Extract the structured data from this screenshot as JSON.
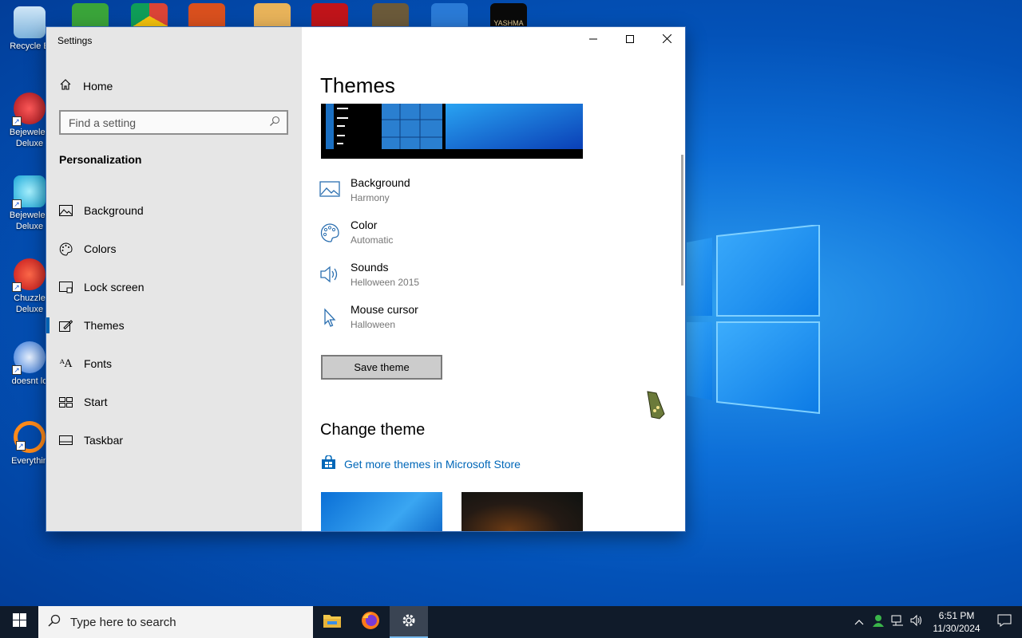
{
  "desktop": {
    "icons": [
      {
        "label": "Recycle B",
        "icon": "recycle-bin-icon"
      },
      {
        "label": "Bejewelec Deluxe",
        "icon": "bejeweled2-icon"
      },
      {
        "label": "Bejewelec Deluxe",
        "icon": "bejeweled-icon"
      },
      {
        "label": "Chuzzle Deluxe",
        "icon": "chuzzle-icon"
      },
      {
        "label": "doesnt lo",
        "icon": "thunderbird-icon"
      },
      {
        "label": "Everythin",
        "icon": "everything-search-icon"
      }
    ],
    "top_icon_text": "YASHMA"
  },
  "window": {
    "title": "Settings",
    "left_pane": {
      "home_label": "Home",
      "search_placeholder": "Find a setting",
      "section_label": "Personalization",
      "nav_items": [
        {
          "label": "Background",
          "icon": "picture-icon"
        },
        {
          "label": "Colors",
          "icon": "palette-icon"
        },
        {
          "label": "Lock screen",
          "icon": "lock-screen-icon"
        },
        {
          "label": "Themes",
          "icon": "themes-icon",
          "selected": true
        },
        {
          "label": "Fonts",
          "icon": "fonts-icon"
        },
        {
          "label": "Start",
          "icon": "start-icon"
        },
        {
          "label": "Taskbar",
          "icon": "taskbar-icon"
        }
      ]
    },
    "main": {
      "title": "Themes",
      "properties": [
        {
          "name": "Background",
          "value": "Harmony",
          "icon": "picture-icon"
        },
        {
          "name": "Color",
          "value": "Automatic",
          "icon": "palette-icon"
        },
        {
          "name": "Sounds",
          "value": "Helloween 2015",
          "icon": "speaker-icon"
        },
        {
          "name": "Mouse cursor",
          "value": "Halloween",
          "icon": "cursor-icon"
        }
      ],
      "save_button": "Save theme",
      "change_theme_heading": "Change theme",
      "store_link": "Get more themes in Microsoft Store"
    }
  },
  "taskbar": {
    "search_placeholder": "Type here to search",
    "apps": [
      "file-explorer-icon",
      "firefox-icon",
      "settings-icon"
    ],
    "time": "6:51 PM",
    "date": "11/30/2024"
  },
  "colors": {
    "accent": "#0063b1",
    "link": "#0067b8",
    "taskbar": "#101b2a"
  }
}
